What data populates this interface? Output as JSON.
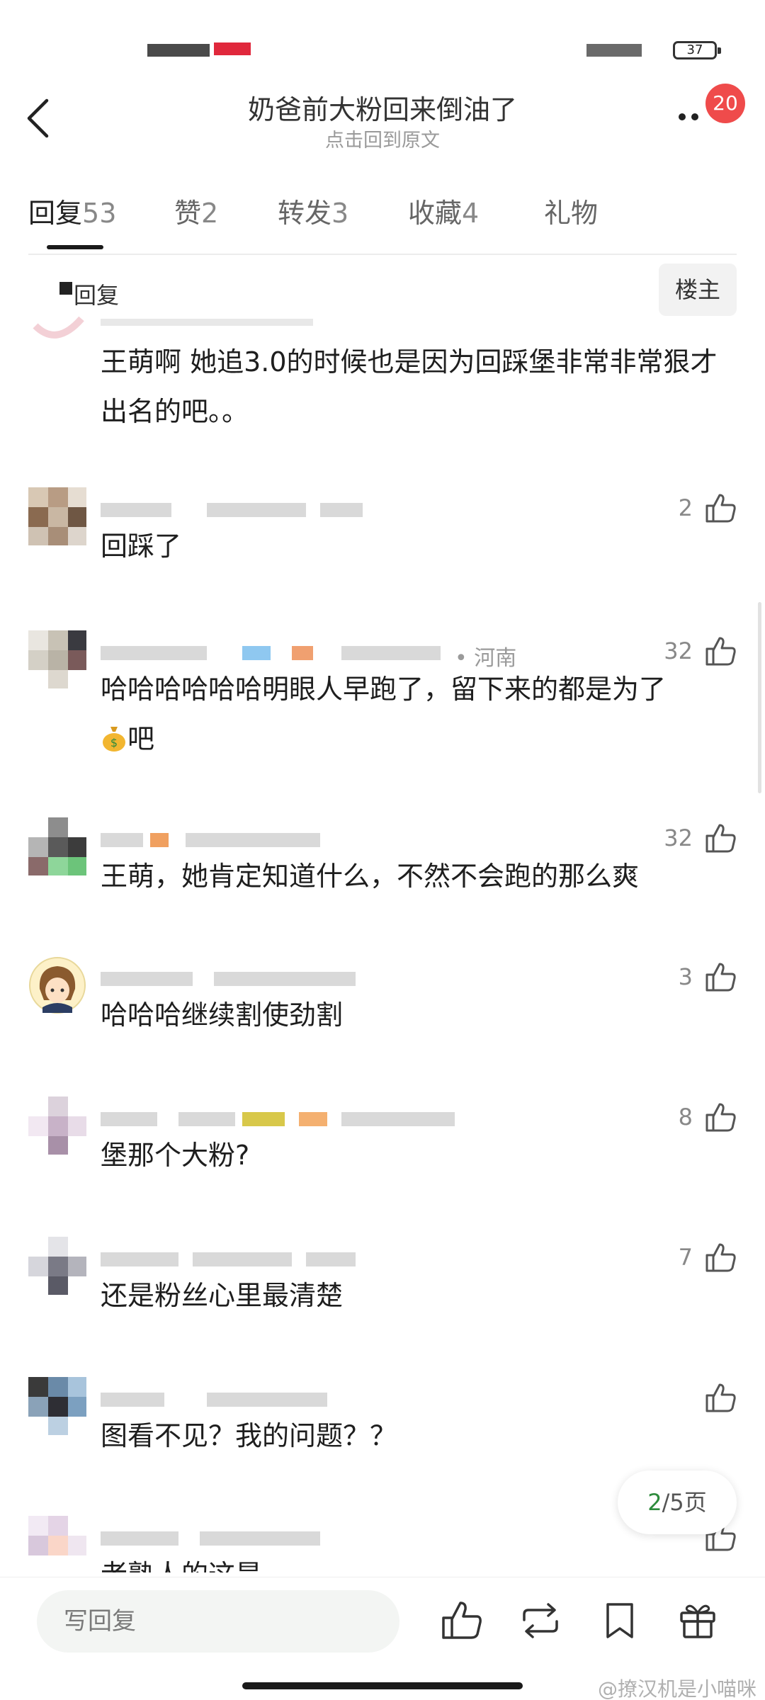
{
  "status_bar": {
    "battery": "37"
  },
  "header": {
    "title": "奶爸前大粉回来倒油了",
    "subtitle": "点击回到原文",
    "notification_count": "20"
  },
  "tabs": [
    {
      "label": "回复",
      "count": "53",
      "active": true
    },
    {
      "label": "赞",
      "count": "2"
    },
    {
      "label": "转发",
      "count": "3"
    },
    {
      "label": "收藏",
      "count": "4"
    },
    {
      "label": "礼物",
      "count": ""
    }
  ],
  "floor_bar": {
    "reply_label": "回复",
    "owner_label": "楼主"
  },
  "comments": [
    {
      "text": "王萌啊 她追3.0的时候也是因为回踩堡非常非常狠才出名的吧。。",
      "likes": "",
      "location": ""
    },
    {
      "text": "回踩了",
      "likes": "2",
      "location": ""
    },
    {
      "text_a": "哈哈哈哈哈哈明眼人早跑了，留下来的都是为了",
      "text_b": "吧",
      "emoji": "money-bag",
      "likes": "32",
      "location": "• 河南"
    },
    {
      "text": "王萌，她肯定知道什么，不然不会跑的那么爽",
      "likes": "32",
      "location": ""
    },
    {
      "text": "哈哈哈继续割使劲割",
      "likes": "3",
      "location": ""
    },
    {
      "text": "堡那个大粉?",
      "likes": "8",
      "location": ""
    },
    {
      "text": "还是粉丝心里最清楚",
      "likes": "7",
      "location": ""
    },
    {
      "text": "图看不见？我的问题？？",
      "likes": "",
      "location": ""
    },
    {
      "text": "老熟人的这是",
      "likes": "",
      "location": ""
    }
  ],
  "pagination": {
    "current": "2",
    "rest": "/5页"
  },
  "bottom_bar": {
    "input_placeholder": "写回复"
  },
  "watermark": "@撩汉机是小喵咪",
  "colors": {
    "accent_green": "#2e8b3c",
    "badge_red": "#ef4b4b"
  }
}
